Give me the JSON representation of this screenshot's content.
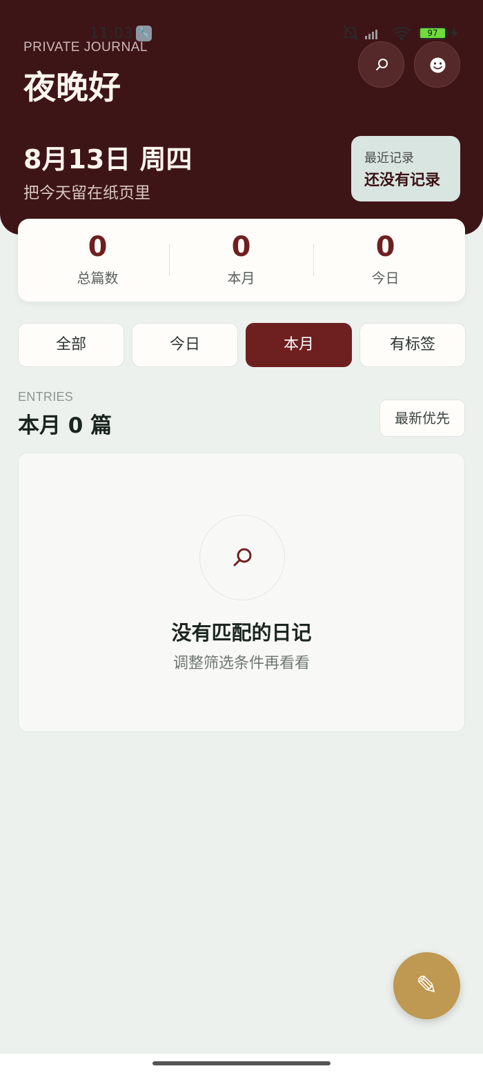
{
  "status_bar": {
    "time": "11:03",
    "battery": "97"
  },
  "header": {
    "eyebrow": "PRIVATE JOURNAL",
    "greeting": "夜晚好",
    "date": "8月13日 周四",
    "subtitle": "把今天留在纸页里",
    "search_icon": "search-icon",
    "profile_icon": "smiley-icon",
    "recent": {
      "label": "最近记录",
      "value": "还没有记录"
    }
  },
  "stats": [
    {
      "value": "0",
      "label": "总篇数"
    },
    {
      "value": "0",
      "label": "本月"
    },
    {
      "value": "0",
      "label": "今日"
    }
  ],
  "filters": [
    {
      "label": "全部",
      "active": false
    },
    {
      "label": "今日",
      "active": false
    },
    {
      "label": "本月",
      "active": true
    },
    {
      "label": "有标签",
      "active": false
    }
  ],
  "entries": {
    "eyebrow": "ENTRIES",
    "title": "本月 0 篇",
    "sort": "最新优先"
  },
  "empty_state": {
    "icon": "search-icon",
    "title": "没有匹配的日记",
    "subtitle": "调整筛选条件再看看"
  },
  "fab": {
    "icon": "pencil-icon",
    "glyph": "✎"
  },
  "colors": {
    "header_bg": "#3e1517",
    "accent": "#6e2020",
    "fab": "#bf9851",
    "page_bg": "#edf1ed"
  }
}
